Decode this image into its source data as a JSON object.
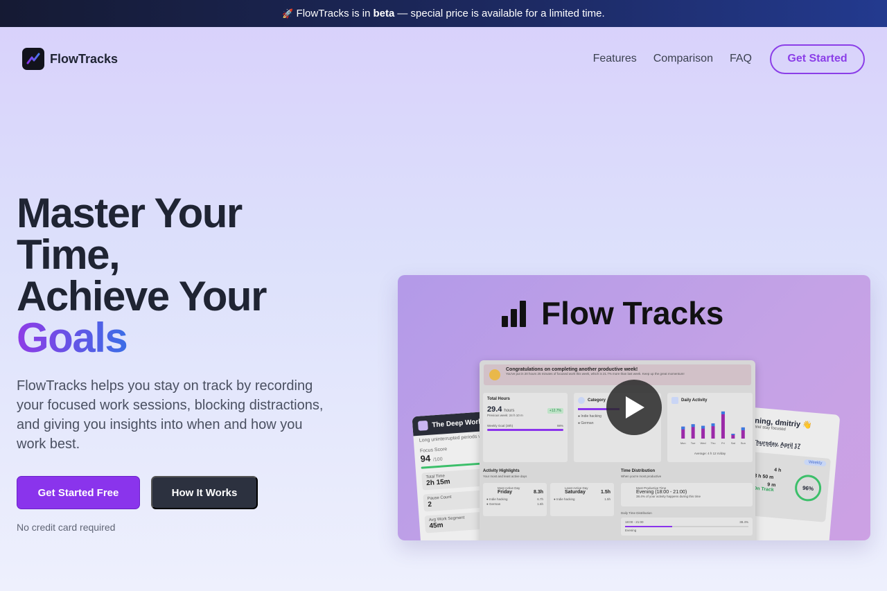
{
  "banner": {
    "icon": "rocket-icon",
    "text_before": "FlowTracks is in",
    "text_bold": "beta",
    "text_after": "— special price is available for a limited time."
  },
  "nav": {
    "brand": "FlowTracks",
    "links": [
      "Features",
      "Comparison",
      "FAQ"
    ],
    "cta": "Get Started"
  },
  "hero": {
    "title_lines": [
      "Master Your",
      "Time,",
      "Achieve Your"
    ],
    "title_accent": "Goals",
    "description": "FlowTracks helps you stay on track by recording your focused work sessions, blocking distractions, and giving you insights into when and how you work best.",
    "primary_cta": "Get Started Free",
    "secondary_cta": "How It Works",
    "note": "No credit card required"
  },
  "video": {
    "brand": "Flow Tracks",
    "left_card": {
      "title": "The Deep Work",
      "subtitle": "Long uninterrupted periods with f",
      "focus_label": "Focus Score",
      "focus_value": "94",
      "focus_max": "/100",
      "stats": [
        {
          "label": "Total Time",
          "value": "2h 15m"
        },
        {
          "label": "Pause Count",
          "value": "2"
        },
        {
          "label": "Avg Work Segment",
          "value": "45m"
        }
      ]
    },
    "right_card": {
      "greeting": "ning, dmitriy 👋",
      "sub": "and stay focused",
      "date": "Thursday, April 17",
      "badge": "Weekly",
      "values": [
        "4 h",
        "3 h 50 m",
        "9 m"
      ],
      "status": "On Track",
      "percent": "96%",
      "percent_fraction": 0.96
    },
    "main": {
      "congrats_title": "Congratulations on completing another productive week!",
      "congrats_sub": "You've put in 20 hours 25 minutes of focused work this week, which is 21.7% more than last week. Keep up the great momentum!",
      "total_hours_label": "Total Hours",
      "total_hours_value": "29.4",
      "total_hours_unit": "hours",
      "total_hours_badge": "+12.7%",
      "prev_week": "Previous week: 24 h 10 m",
      "weekly_goal_label": "Weekly Goal (30h)",
      "weekly_goal_pct": "98%",
      "category_label": "Category",
      "categories": [
        "Indie hacking",
        "German"
      ],
      "daily_label": "Daily Activity",
      "days": [
        "Mon",
        "Tue",
        "Wed",
        "Thu",
        "Fri",
        "Sat",
        "Sun"
      ],
      "daily_values": [
        1.5,
        1.8,
        1.6,
        1.9,
        3.4,
        0.6,
        1.4
      ],
      "daily_average": "Average: 4 h 12 m/day",
      "highlights_label": "Activity Highlights",
      "highlights_sub": "Your most and least active days",
      "most_active": {
        "label": "Most Active Day",
        "day": "Friday",
        "value": "8.3h",
        "items": [
          [
            "Indie hacking",
            "6.7h"
          ],
          [
            "German",
            "1.6h"
          ]
        ]
      },
      "least_active": {
        "label": "Least Active Day",
        "day": "Saturday",
        "value": "1.5h",
        "items": [
          [
            "Indie hacking",
            "1.5h"
          ]
        ]
      },
      "distribution_label": "Time Distribution",
      "distribution_sub": "When you're most productive",
      "productive_label": "Most Productive Time",
      "productive_value": "Evening (18:00 - 21:00)",
      "productive_sub": "38.4% of your activity happens during this time",
      "daily_dist_label": "Daily Time Distribution",
      "slot": "18:00 - 21:00",
      "slot_pct": "38.4%",
      "slot_fraction": 0.384,
      "slot_name": "Evening"
    }
  },
  "colors": {
    "accent": "#8a34ec",
    "dark": "#2c313f"
  }
}
